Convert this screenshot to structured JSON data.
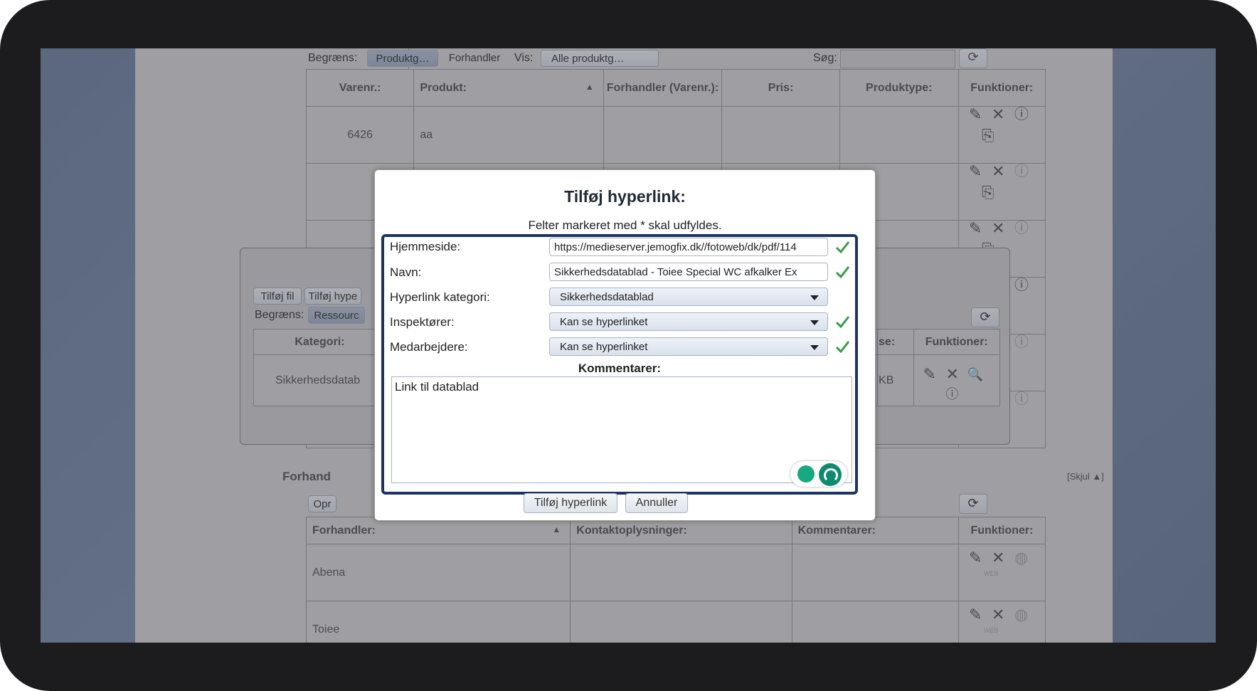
{
  "top": {
    "begraens_label": "Begræns:",
    "btn_produktg": "Produktg…",
    "btn_forhandler": "Forhandler",
    "vis_label": "Vis:",
    "vis_select": "Alle produktg…",
    "search_label": "Søg:",
    "search_value": ""
  },
  "products_table": {
    "headers": [
      "Varenr.:",
      "Produkt:",
      "Forhandler (Varenr.):",
      "Pris:",
      "Produktype:",
      "Funktioner:"
    ],
    "first_row": {
      "varenr": "6426",
      "produkt": "aa"
    }
  },
  "back_panel": {
    "btn_tilfoj_fil": "Tilføj fil",
    "btn_tilfoj_hyper": "Tilføj hype",
    "begraens_label": "Begræns:",
    "btn_ressource": "Ressourc",
    "header_kategori": "Kategori:",
    "header_size_partial": "se:",
    "header_funktioner": "Funktioner:",
    "row_kategori": "Sikkerhedsdatab",
    "row_size": "KB"
  },
  "dealers": {
    "section_label": "Forhand",
    "hide_link": "[Skjul ▲]",
    "btn_opret": "Opr",
    "headers": [
      "Forhandler:",
      "Kontaktoplysninger:",
      "Kommentarer:",
      "Funktioner:"
    ],
    "rows": [
      "Abena",
      "Toiee"
    ],
    "web_label": "WEB"
  },
  "dialog": {
    "title": "Tilføj hyperlink:",
    "subtitle": "Felter markeret med * skal udfyldes.",
    "hjemmeside_label": "Hjemmeside:",
    "hjemmeside_value": "https://medieserver.jemogfix.dk//fotoweb/dk/pdf/114",
    "navn_label": "Navn:",
    "navn_value": "Sikkerhedsdatablad - Toiee Special WC afkalker Ex",
    "kategori_label": "Hyperlink kategori:",
    "kategori_value": "Sikkerhedsdatablad",
    "inspektorer_label": "Inspektører:",
    "inspektorer_value": "Kan se hyperlinket",
    "medarbejdere_label": "Medarbejdere:",
    "medarbejdere_value": "Kan se hyperlinket",
    "kommentarer_label": "Kommentarer:",
    "kommentarer_value": "Link til datablad",
    "submit_label": "Tilføj hyperlink",
    "cancel_label": "Annuller"
  },
  "colors": {
    "check_green": "#3a9a4a",
    "focus_border": "#1c3560",
    "grammarly_green": "#0e8a6f"
  }
}
